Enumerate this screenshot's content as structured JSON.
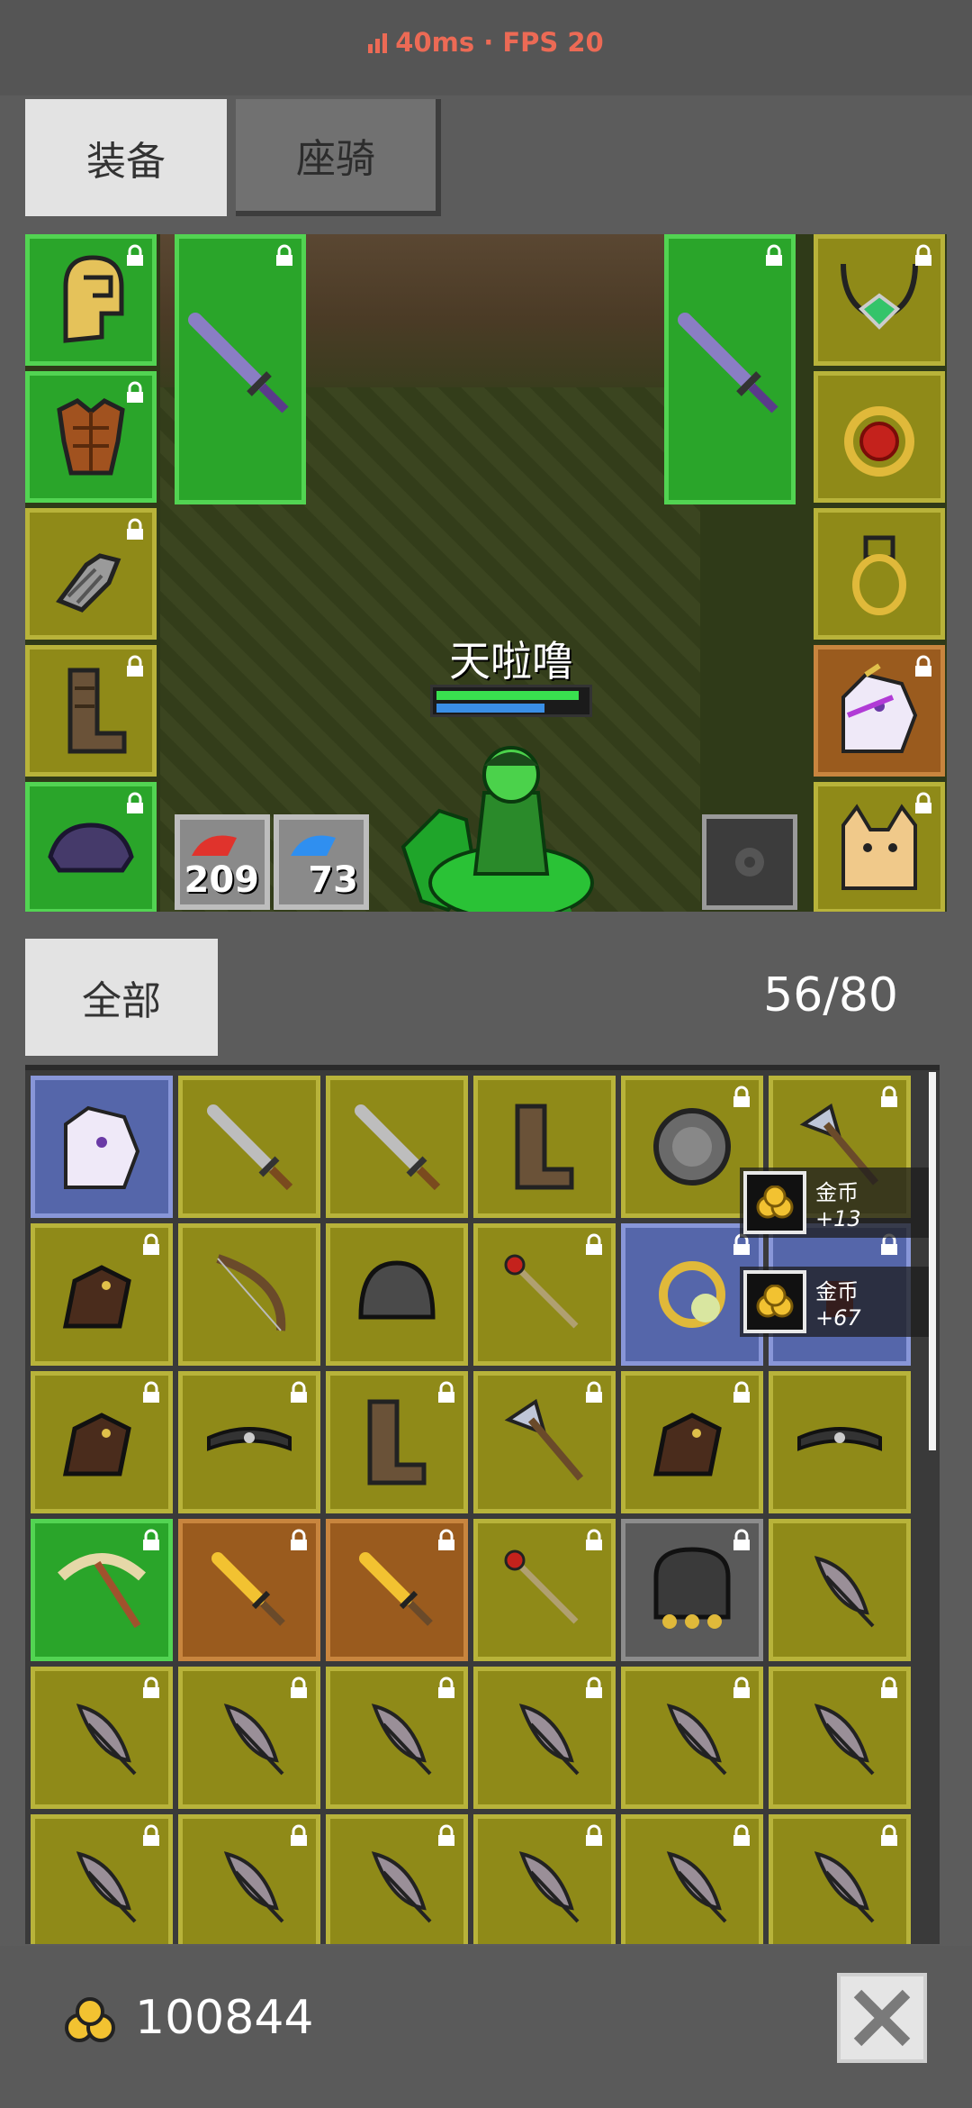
{
  "status": {
    "ping": "40ms",
    "separator": " · ",
    "fps": "FPS 20"
  },
  "tabs": [
    {
      "label": "装备",
      "active": true
    },
    {
      "label": "座骑",
      "active": false
    }
  ],
  "character": {
    "name": "天啦噜",
    "hp_fraction": 0.95,
    "mp_fraction": 0.72
  },
  "equipment": {
    "left": [
      {
        "item": "gold-helmet",
        "rarity": "green",
        "locked": true
      },
      {
        "item": "leather-armor",
        "rarity": "green",
        "locked": true
      },
      {
        "item": "gauntlet",
        "rarity": "olive",
        "locked": true
      },
      {
        "item": "boots",
        "rarity": "olive",
        "locked": true
      },
      {
        "item": "purple-hat",
        "rarity": "green",
        "locked": true
      }
    ],
    "weapons": [
      {
        "item": "purple-sword-left",
        "rarity": "green",
        "locked": true
      },
      {
        "item": "purple-sword-right",
        "rarity": "green",
        "locked": true
      }
    ],
    "right": [
      {
        "item": "emerald-necklace",
        "rarity": "olive",
        "locked": true
      },
      {
        "item": "ruby-ring",
        "rarity": "olive",
        "locked": true
      },
      {
        "item": "gold-ring",
        "rarity": "olive",
        "locked": false
      },
      {
        "item": "unicorn-mount",
        "rarity": "brown",
        "locked": true
      },
      {
        "item": "cat-pet",
        "rarity": "olive",
        "locked": true
      }
    ]
  },
  "potions": [
    {
      "type": "red-potion",
      "count": "209",
      "color": "#e0332c"
    },
    {
      "type": "blue-potion",
      "count": "73",
      "color": "#2f8ff0"
    }
  ],
  "inventory": {
    "filter_label": "全部",
    "count": "56/80",
    "slots": [
      [
        "unicorn-card:blue",
        "iron-sword:olive",
        "iron-sword:olive",
        "boots:olive",
        "round-shield:olive:lock",
        "battle-axe:olive:lock"
      ],
      [
        "leather-glove:olive:lock",
        "bow:olive",
        "iron-helmet:olive",
        "ruby-staff:olive:lock",
        "gold-ring:blue:lock",
        "unknown:blue:lock"
      ],
      [
        "leather-glove:olive:lock",
        "belt:olive:lock",
        "boots:olive:lock",
        "battle-axe:olive:lock",
        "leather-glove:olive:lock",
        "belt:olive"
      ],
      [
        "gold-pickaxe:green:lock",
        "gold-dagger:brown:lock",
        "gold-dagger:brown:lock",
        "ruby-staff:olive:lock",
        "dark-helmet:gray:lock",
        "feather:olive"
      ],
      [
        "feather:olive:lock",
        "feather:olive:lock",
        "feather:olive:lock",
        "feather:olive:lock",
        "feather:olive:lock",
        "feather:olive:lock"
      ],
      [
        "feather:olive:lock",
        "feather:olive:lock",
        "feather:olive:lock",
        "feather:olive:lock",
        "feather:olive:lock",
        "feather:olive:lock"
      ]
    ]
  },
  "toasts": [
    {
      "label": "金币",
      "amount": "+13"
    },
    {
      "label": "金币",
      "amount": "+67"
    }
  ],
  "footer": {
    "gold": "100844"
  },
  "colors": {
    "status_text": "#ec6a55",
    "green_slot": "#2aa52a",
    "olive_slot": "#8f8a18",
    "brown_slot": "#9a5b1e",
    "blue_slot": "#5566aa"
  }
}
